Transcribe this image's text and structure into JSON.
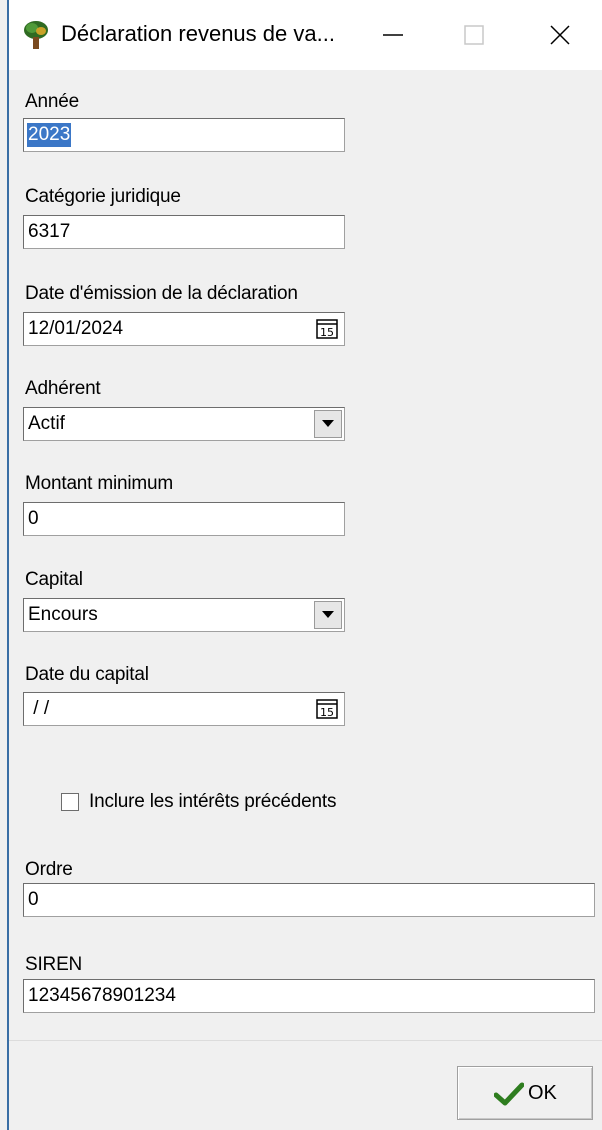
{
  "window": {
    "title": "Déclaration revenus de va...",
    "app_icon": "tree-globe-icon",
    "controls": [
      "minimize-icon",
      "maximize-icon",
      "close-icon"
    ]
  },
  "form": {
    "annee": {
      "label": "Année",
      "value": "2023"
    },
    "categorie": {
      "label": "Catégorie juridique",
      "value": "6317"
    },
    "date_emission": {
      "label": "Date d'émission de la déclaration",
      "value": "12/01/2024"
    },
    "adherent": {
      "label": "Adhérent",
      "value": "Actif"
    },
    "montant_min": {
      "label": "Montant minimum",
      "value": "0"
    },
    "capital": {
      "label": "Capital",
      "value": "Encours"
    },
    "date_capital": {
      "label": "Date du capital",
      "value": " / /"
    },
    "inclure_interets": {
      "label": "Inclure les intérêts précédents",
      "checked": false
    },
    "ordre": {
      "label": "Ordre",
      "value": "0"
    },
    "siren": {
      "label": "SIREN",
      "value": "12345678901234"
    }
  },
  "calendar_icon_text": "15",
  "ok_button": {
    "label": "OK"
  },
  "colors": {
    "selection": "#3b77c7",
    "ok_check": "#2e7d1f",
    "window_border": "#3a6ea5"
  }
}
